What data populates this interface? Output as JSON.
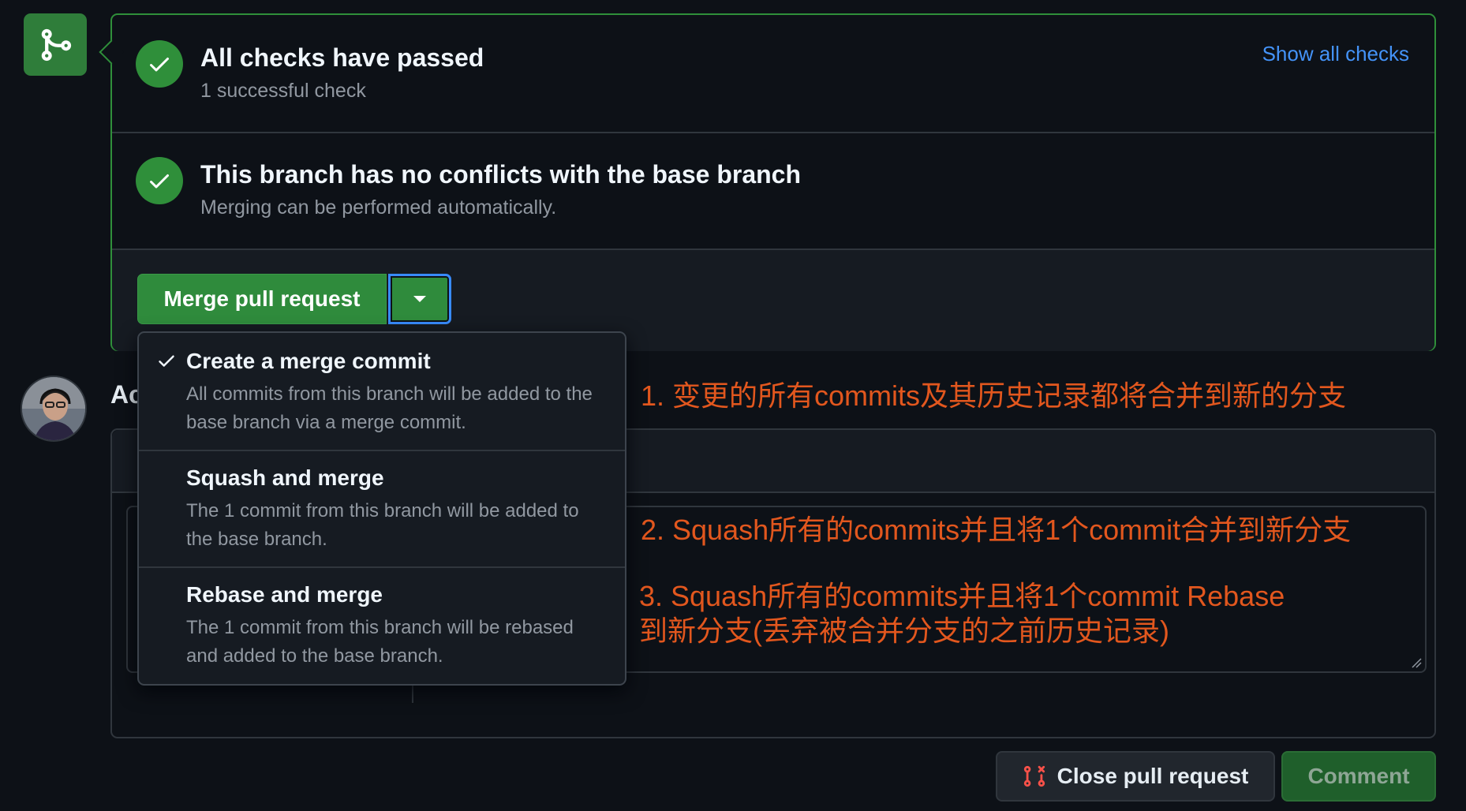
{
  "checks": {
    "title": "All checks have passed",
    "subtitle": "1 successful check",
    "show_all_link": "Show all checks"
  },
  "conflicts": {
    "title": "This branch has no conflicts with the base branch",
    "subtitle": "Merging can be performed automatically."
  },
  "merge": {
    "button_label": "Merge pull request"
  },
  "dropdown": {
    "selected": "Create a merge commit",
    "items": [
      {
        "title": "Create a merge commit",
        "description": "All commits from this branch will be added to the base branch via a merge commit."
      },
      {
        "title": "Squash and merge",
        "description": "The 1 commit from this branch will be added to the base branch."
      },
      {
        "title": "Rebase and merge",
        "description": "The 1 commit from this branch will be rebased and added to the base branch."
      }
    ]
  },
  "comment": {
    "heading_partial": "Ac"
  },
  "annotations": {
    "note1": "1. 变更的所有commits及其历史记录都将合并到新的分支",
    "note2": "2. Squash所有的commits并且将1个commit合并到新分支",
    "note3_line1": "3. Squash所有的commits并且将1个commit Rebase",
    "note3_line2": "到新分支(丢弃被合并分支的之前历史记录)"
  },
  "footer": {
    "close_label": "Close pull request",
    "comment_label": "Comment"
  },
  "colors": {
    "background": "#0d1117",
    "success_green": "#2f8f3a",
    "link_blue": "#4493f8",
    "annotation_orange": "#e2571e",
    "danger_red": "#f85149"
  },
  "icons": [
    "git-merge-icon",
    "check-icon",
    "triangle-down-icon",
    "git-pull-request-closed-icon",
    "avatar"
  ]
}
